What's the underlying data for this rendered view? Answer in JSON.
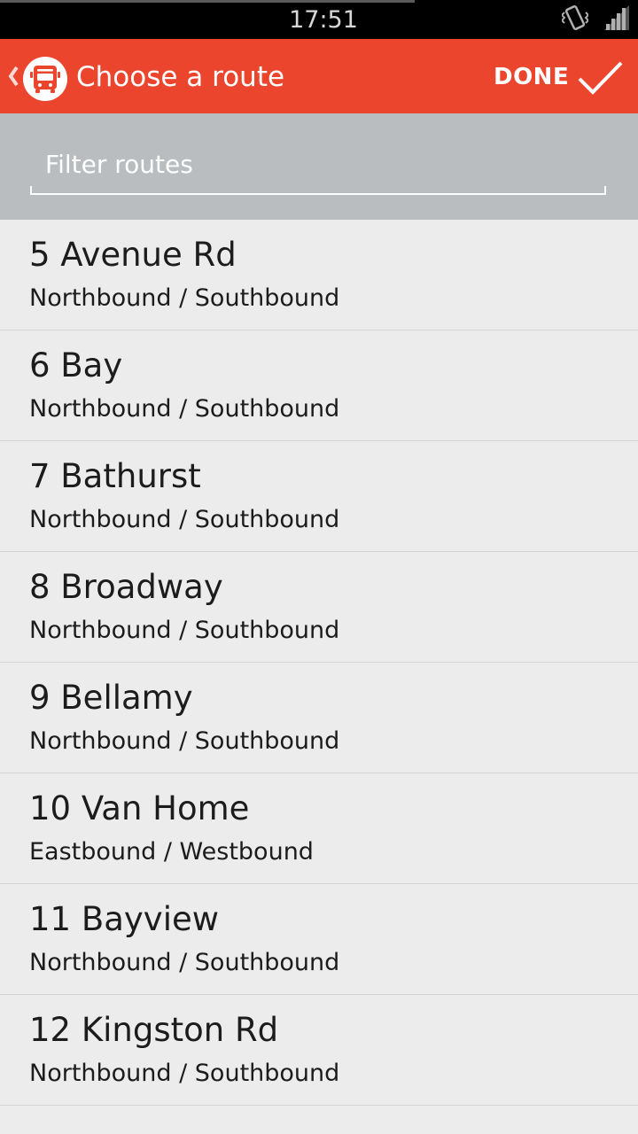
{
  "status_bar": {
    "time": "17:51",
    "icons": [
      "vibrate-icon",
      "signal-icon"
    ]
  },
  "action_bar": {
    "up_icon": "chevron-left-icon",
    "logo_icon": "bus-icon",
    "title": "Choose a route",
    "done_label": "DONE",
    "done_icon": "check-icon"
  },
  "filter": {
    "placeholder": "Filter routes",
    "value": ""
  },
  "routes": [
    {
      "name": "5 Avenue Rd",
      "directions": "Northbound / Southbound"
    },
    {
      "name": "6 Bay",
      "directions": "Northbound / Southbound"
    },
    {
      "name": "7 Bathurst",
      "directions": "Northbound / Southbound"
    },
    {
      "name": "8 Broadway",
      "directions": "Northbound / Southbound"
    },
    {
      "name": "9 Bellamy",
      "directions": "Northbound / Southbound"
    },
    {
      "name": "10 Van Home",
      "directions": "Eastbound / Westbound"
    },
    {
      "name": "11 Bayview",
      "directions": "Northbound / Southbound"
    },
    {
      "name": "12 Kingston Rd",
      "directions": "Northbound / Southbound"
    }
  ],
  "colors": {
    "accent": "#ec452d",
    "filter_panel": "#b9bdc0",
    "list_background": "#ececec",
    "status_bar": "#000000"
  }
}
